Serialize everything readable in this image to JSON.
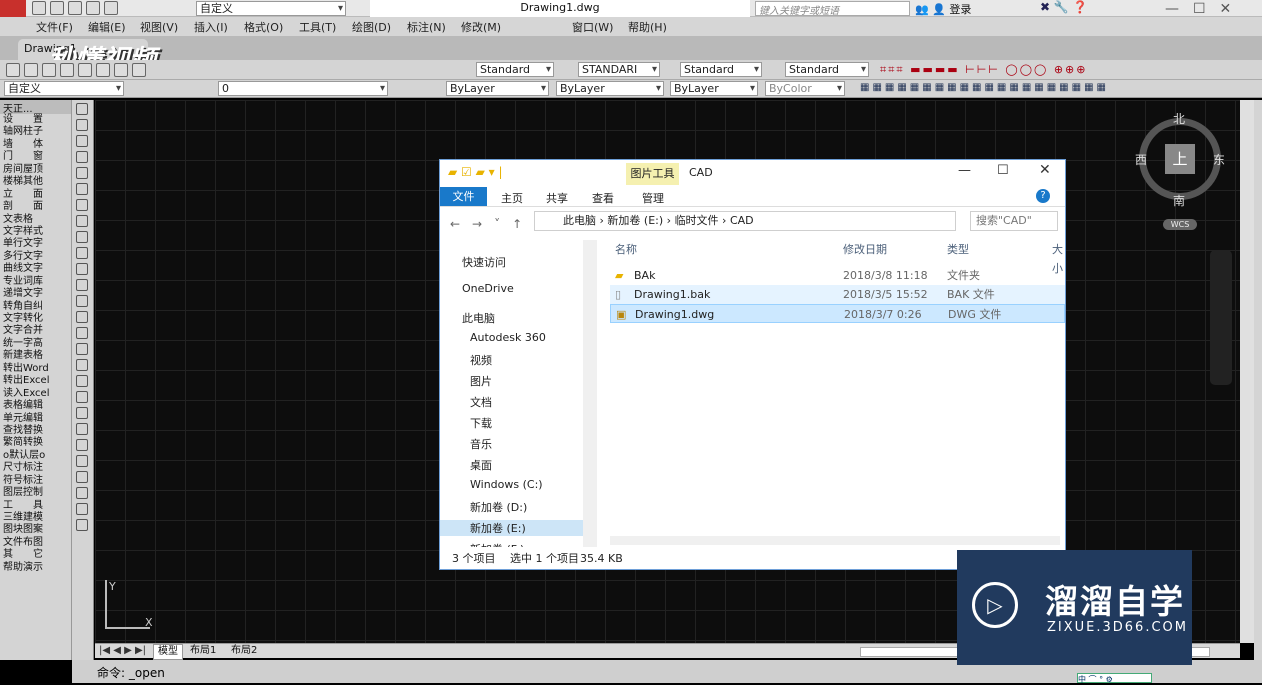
{
  "app": {
    "title": "Drawing1.dwg",
    "workspace": "自定义",
    "search_placeholder": "键入关键字或短语",
    "login": "登录"
  },
  "menu": [
    "文件(F)",
    "编辑(E)",
    "视图(V)",
    "插入(I)",
    "格式(O)",
    "工具(T)",
    "绘图(D)",
    "标注(N)",
    "修改(M)",
    "窗口(W)",
    "帮助(H)"
  ],
  "tab_label": "Drawing1",
  "toolbar": {
    "styles": [
      "Standard",
      "STANDARI",
      "Standard",
      "Standard"
    ],
    "workspace2": "自定义",
    "layer": "0",
    "color": "ByLayer",
    "linetype": "ByLayer",
    "lineweight": "ByLayer",
    "plotstyle": "ByColor"
  },
  "left_panel": {
    "header": "天正...",
    "items": [
      "设　　置",
      "轴网柱子",
      "墙　　体",
      "门　　窗",
      "房间屋顶",
      "楼梯其他",
      "立　　面",
      "剖　　面",
      "文表格",
      "文字样式",
      "单行文字",
      "多行文字",
      "曲线文字",
      "专业词库",
      "递增文字",
      "转角自纠",
      "文字转化",
      "文字合并",
      "统一字高",
      "新建表格",
      "转出Word",
      "转出Excel",
      "读入Excel",
      "表格编辑",
      "单元编辑",
      "查找替换",
      "繁简转换",
      "o默认层o",
      "尺寸标注",
      "符号标注",
      "图层控制",
      "工　　具",
      "三维建模",
      "图块图案",
      "文件布图",
      "其　　它",
      "帮助演示"
    ]
  },
  "viewcube": {
    "north": "北",
    "south": "南",
    "east": "东",
    "west": "西",
    "top": "上",
    "wcs": "WCS"
  },
  "ucs": {
    "y": "Y",
    "x": "X"
  },
  "layout_tabs": [
    "模型",
    "布局1",
    "布局2"
  ],
  "command": "命令: _open",
  "explorer": {
    "context_tab": "图片工具",
    "title": "CAD",
    "ribbon": [
      "文件",
      "主页",
      "共享",
      "查看",
      "管理"
    ],
    "path": [
      "此电脑",
      "新加卷 (E:)",
      "临时文件",
      "CAD"
    ],
    "search_placeholder": "搜索\"CAD\"",
    "columns": [
      "名称",
      "修改日期",
      "类型",
      "大小"
    ],
    "nav": [
      "快速访问",
      "OneDrive",
      "此电脑",
      "Autodesk 360",
      "视频",
      "图片",
      "文档",
      "下载",
      "音乐",
      "桌面",
      "Windows (C:)",
      "新加卷 (D:)",
      "新加卷 (E:)",
      "新加卷 (F:)"
    ],
    "files": [
      {
        "name": "BAk",
        "date": "2018/3/8 11:18",
        "type": "文件夹"
      },
      {
        "name": "Drawing1.bak",
        "date": "2018/3/5 15:52",
        "type": "BAK 文件"
      },
      {
        "name": "Drawing1.dwg",
        "date": "2018/3/7 0:26",
        "type": "DWG 文件"
      }
    ],
    "status": {
      "count": "3 个项目",
      "selected": "选中 1 个项目",
      "size": "35.4 KB"
    }
  },
  "watermark": {
    "logo_text": "秒懂视频",
    "brand": "溜溜自学",
    "url": "ZIXUE.3D66.COM"
  }
}
